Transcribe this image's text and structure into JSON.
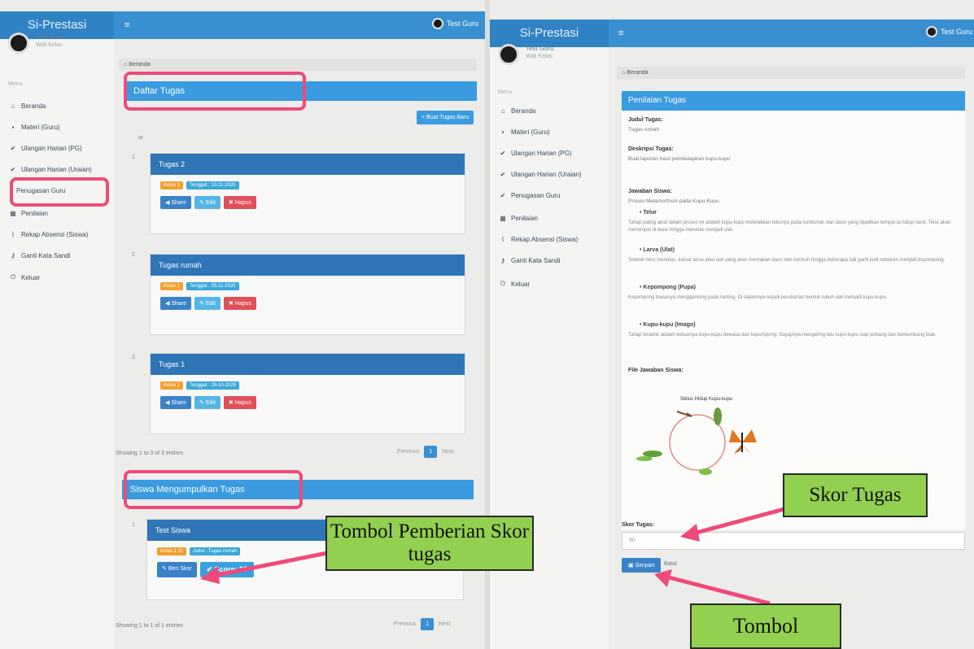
{
  "app": {
    "brand": "Si-Prestasi",
    "menu_icon": "≡"
  },
  "left": {
    "user": {
      "name": "Test Guru",
      "role": "Wali Kelas"
    },
    "topbar_user": "Test Guru",
    "menu_label": "Menu",
    "menu": [
      {
        "icon": "home-icon",
        "glyph": "⌂",
        "label": "Beranda"
      },
      {
        "icon": "folder-icon",
        "glyph": "▪",
        "label": "Materi (Guru)"
      },
      {
        "icon": "check-icon",
        "glyph": "✔",
        "label": "Ulangan Harian (PG)"
      },
      {
        "icon": "check-icon",
        "glyph": "✔",
        "label": "Ulangan Harian (Uraian)"
      },
      {
        "icon": "none",
        "glyph": "",
        "label": "Penugasan Guru"
      },
      {
        "icon": "table-icon",
        "glyph": "▦",
        "label": "Penilaian"
      },
      {
        "icon": "chart-icon",
        "glyph": "⌇",
        "label": "Rekap Absensi (Siswa)"
      },
      {
        "icon": "key-icon",
        "glyph": "⚷",
        "label": "Ganti Kata Sandi"
      },
      {
        "icon": "power-icon",
        "glyph": "⏻",
        "label": "Keluar"
      }
    ],
    "breadcrumb": "Beranda",
    "tugas_title": "Daftar Tugas",
    "add_button": "+ Buat Tugas Baru",
    "cards": [
      {
        "num": "1",
        "title": "Tugas 2",
        "badge1": "Kelas 1",
        "badge2": "Tenggat : 10-11-2020"
      },
      {
        "num": "2",
        "title": "Tugas rumah",
        "badge1": "Kelas 1",
        "badge2": "Tenggat : 05-11-2020"
      },
      {
        "num": "3",
        "title": "Tugas 1",
        "badge1": "Kelas 1",
        "badge2": "Tenggat : 28-10-2020"
      }
    ],
    "card_buttons": {
      "share": "Share",
      "edit": "Edit",
      "delete": "Hapus"
    },
    "showing1": "Showing 1 to 3 of 3 entries",
    "pager": {
      "prev": "Previous",
      "page": "1",
      "next": "Next"
    },
    "submit_title": "Siswa Mengumpulkan Tugas",
    "submit_card": {
      "num": "1",
      "title": "Test Siswa",
      "badge1": "Kelas 1 ID",
      "badge2": "Judul : Tugas rumah",
      "give_score": "Beri Skor",
      "score": "Score: 90"
    },
    "showing2": "Showing 1 to 1 of 1 entries"
  },
  "right": {
    "user": {
      "name": "Test Guru",
      "role": "Wali Kelas"
    },
    "topbar_user": "Test Guru",
    "menu_label": "Menu",
    "menu": [
      {
        "glyph": "⌂",
        "label": "Beranda"
      },
      {
        "glyph": "▪",
        "label": "Materi (Guru)"
      },
      {
        "glyph": "✔",
        "label": "Ulangan Harian (PG)"
      },
      {
        "glyph": "✔",
        "label": "Ulangan Harian (Uraian)"
      },
      {
        "glyph": "✔",
        "label": "Penugasan Guru"
      },
      {
        "glyph": "▦",
        "label": "Penilaian"
      },
      {
        "glyph": "⌇",
        "label": "Rekap Absensi (Siswa)"
      },
      {
        "glyph": "⚷",
        "label": "Ganti Kata Sandi"
      },
      {
        "glyph": "⏻",
        "label": "Keluar"
      }
    ],
    "breadcrumb": "Beranda",
    "panel_title": "Penilaian Tugas",
    "judul_label": "Judul Tugas:",
    "judul_value": "Tugas rumah",
    "desk_label": "Deskripsi Tugas:",
    "desk_value": "Buat laporan hasil pembelajaran kupu-kupu",
    "jawaban_label": "Jawaban Siswa:",
    "jawaban_intro": "Proses Metamorfosis pada Kupu-Kupu",
    "stages": [
      {
        "title": "Telur",
        "text": "Tahap paling awal dalam proses ini adalah kupu-kupu meletakkan telurnya pada tumbuhan dan daun yang dijadikan tempat ia hidup nanti. Telur akan menempel di daun hingga menetas menjadi ulat."
      },
      {
        "title": "Larva (Ulat)",
        "text": "Setelah telur menetas, keluar larva atau ulat yang akan memakan daun dan tumbuh hingga beberapa kali ganti kulit sebelum menjadi kepompong."
      },
      {
        "title": "Kepompong (Pupa)",
        "text": "Kepompong biasanya menggantung pada ranting. Di dalamnya terjadi perubahan bentuk tubuh ulat menjadi kupu-kupu."
      },
      {
        "title": "Kupu-kupu (Imago)",
        "text": "Tahap terakhir adalah keluarnya kupu-kupu dewasa dari kepompong. Sayapnya mengering lalu kupu-kupu siap terbang dan berkembang biak."
      }
    ],
    "file_label": "File Jawaban Siswa:",
    "diagram_title": "Siklus Hidup Kupu-kupu",
    "score_label": "Skor Tugas:",
    "score_value": "90",
    "save_button": "Simpan",
    "back_link": "Batal"
  },
  "callouts": {
    "pemberian": "Tombol Pemberian Skor tugas",
    "skor": "Skor Tugas",
    "tombol": "Tombol"
  },
  "colors": {
    "accent": "#3a9be0",
    "highlight": "#ee4a7a",
    "callout": "#92d050"
  }
}
